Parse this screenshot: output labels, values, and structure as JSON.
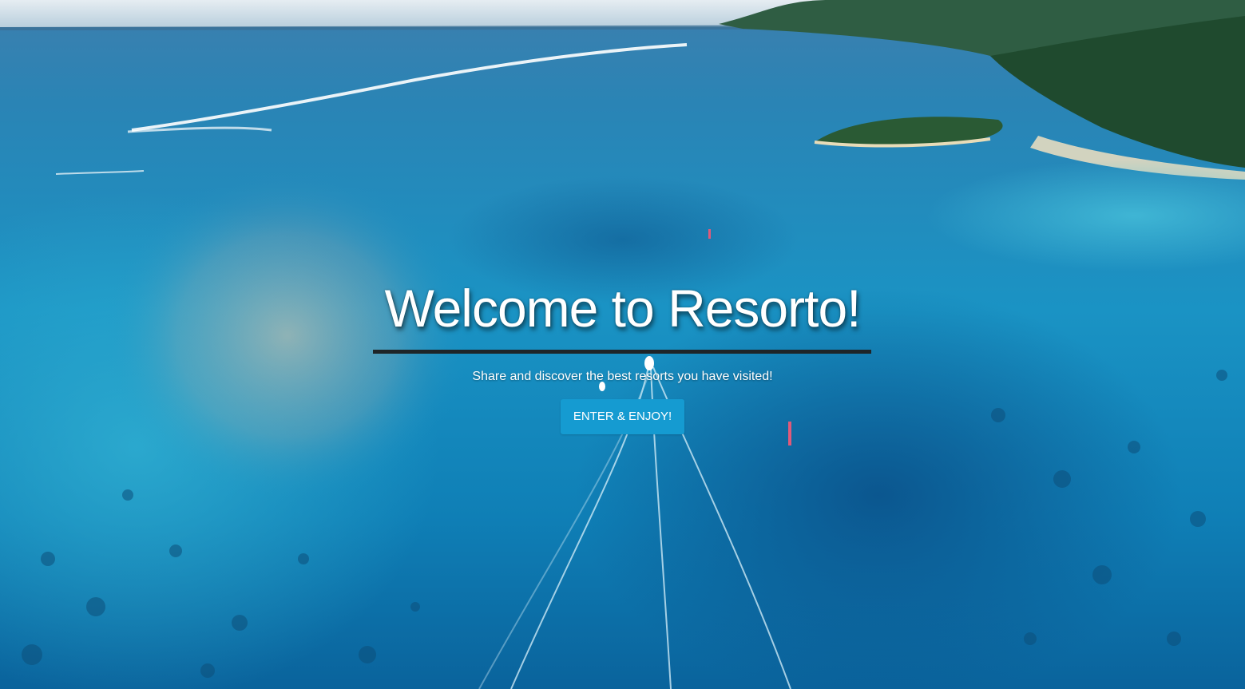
{
  "hero": {
    "title": "Welcome to Resorto!",
    "subtitle": "Share and discover the best resorts you have visited!",
    "button_label": "ENTER & ENJOY!"
  },
  "background": {
    "image": "aerial-lagoon-photo",
    "colors": {
      "deep_water": "#0a5f96",
      "lagoon": "#1f9dc7",
      "sky": "#dbe7ef",
      "island": "#1f4a2e"
    }
  },
  "colors": {
    "accent": "#159bd1",
    "rule": "#1e2528",
    "text": "#ffffff"
  }
}
